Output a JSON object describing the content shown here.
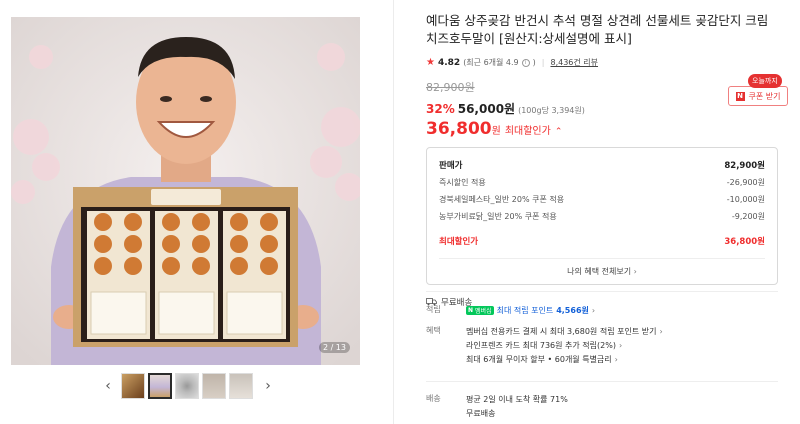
{
  "gallery": {
    "counter": "2 / 13",
    "box_label": "예다움 상주곶감",
    "card_text": "예다움 곶감"
  },
  "thumbs": {
    "prev_icon": "chevron-left-icon",
    "next_icon": "chevron-right-icon"
  },
  "product": {
    "title": "예다움 상주곶감 반건시 추석 명절 상견례 선물세트 곶감단지 크림치즈호두말이 [원산지:상세설명에 표시]",
    "rating": "4.82",
    "rating_detail": "(최근 6개월 4.9",
    "rating_detail_end": ")",
    "review_link": "8,436건 리뷰",
    "original_price": "82,900원",
    "discount_rate": "32%",
    "sale_price": "56,000원",
    "unit_price": "(100g당 3,394원)",
    "max_price": "36,800",
    "max_price_unit": "원",
    "max_label": "최대할인가"
  },
  "coupon": {
    "badge": "오늘까지",
    "icon": "N",
    "label": "쿠폰 받기"
  },
  "breakdown": {
    "head_label": "판매가",
    "head_value": "82,900원",
    "rows": [
      {
        "label": "즉시할인 적용",
        "value": "-26,900원"
      },
      {
        "label": "경북세일페스타_일반 20% 쿠폰 적용",
        "value": "-10,000원"
      },
      {
        "label": "농부가비료닭_일반 20% 쿠폰 적용",
        "value": "-9,200원"
      }
    ],
    "total_label": "최대할인가",
    "total_value": "36,800원",
    "all_benefits": "나의 혜택 전체보기"
  },
  "shipping": {
    "free": "무료배송"
  },
  "points": {
    "label": "적립",
    "badge_n": "N",
    "badge_text": "멤버십",
    "text": "최대 적립 포인트",
    "amount": "4,566원"
  },
  "benefits": {
    "label": "혜택",
    "lines": [
      "멤버십 전용카드 결제 시 최대 3,680원 적립 포인트 받기",
      "라인프렌즈 카드 최대 736원 추가 적립(2%)",
      "최대 6개월 무이자 할부 • 60개월 특별금리"
    ]
  },
  "delivery": {
    "label": "배송",
    "line1": "평균 2일 이내 도착 확률 71%",
    "line2": "무료배송"
  },
  "colors": {
    "accent_red": "#f02d2d",
    "naver_green": "#03c75a",
    "link_blue": "#1461d8"
  }
}
